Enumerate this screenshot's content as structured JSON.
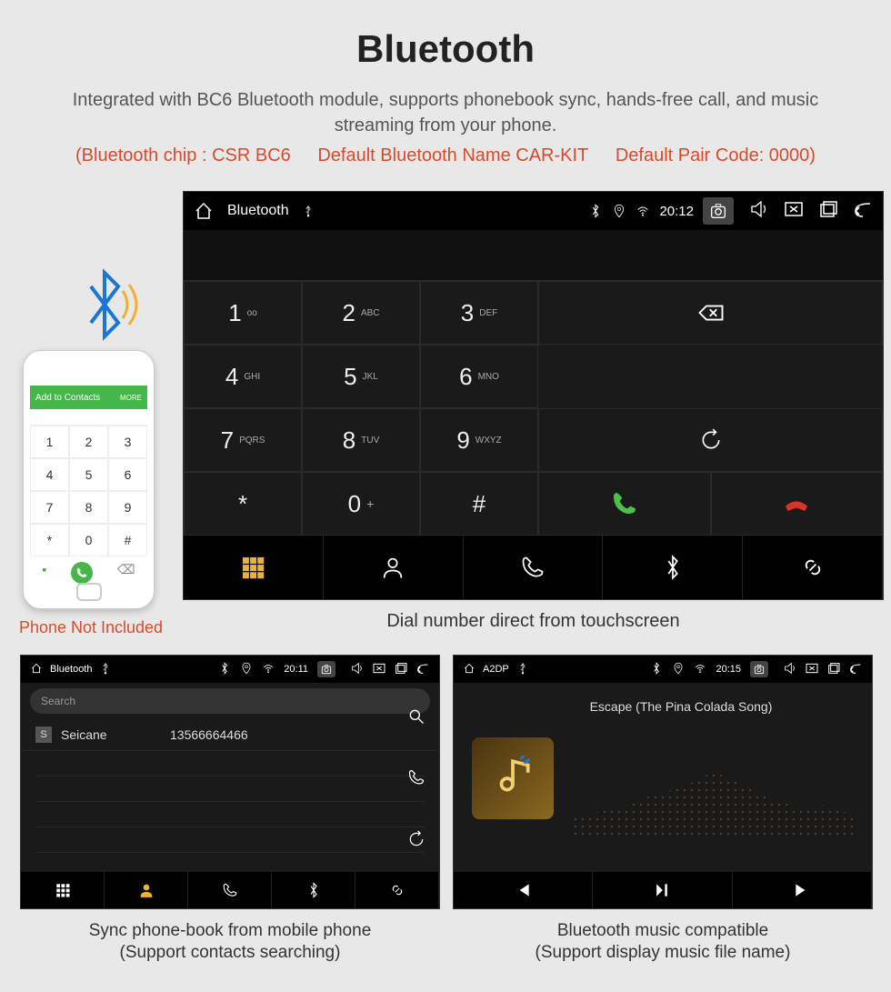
{
  "page": {
    "title": "Bluetooth",
    "subtitle": "Integrated with BC6 Bluetooth module, supports phonebook sync, hands-free call, and music streaming from your phone.",
    "spec_chip": "(Bluetooth chip : CSR BC6",
    "spec_name": "Default Bluetooth Name CAR-KIT",
    "spec_pair": "Default Pair Code: 0000)"
  },
  "dialer": {
    "statusbar_title": "Bluetooth",
    "time": "20:12",
    "keys": [
      {
        "num": "1",
        "sub": "oo"
      },
      {
        "num": "2",
        "sub": "ABC"
      },
      {
        "num": "3",
        "sub": "DEF"
      },
      {
        "num": "4",
        "sub": "GHI"
      },
      {
        "num": "5",
        "sub": "JKL"
      },
      {
        "num": "6",
        "sub": "MNO"
      },
      {
        "num": "7",
        "sub": "PQRS"
      },
      {
        "num": "8",
        "sub": "TUV"
      },
      {
        "num": "9",
        "sub": "WXYZ"
      },
      {
        "num": "*",
        "sub": ""
      },
      {
        "num": "0",
        "sub": "+"
      },
      {
        "num": "#",
        "sub": ""
      }
    ],
    "caption": "Dial number direct from touchscreen"
  },
  "phone": {
    "topbar_label": "Add to Contacts",
    "topbar_right": "MORE",
    "caption": "Phone Not Included"
  },
  "phonebook": {
    "statusbar_title": "Bluetooth",
    "time": "20:11",
    "search_placeholder": "Search",
    "contact": {
      "badge": "S",
      "name": "Seicane",
      "number": "13566664466"
    },
    "caption_line1": "Sync phone-book from mobile phone",
    "caption_line2": "(Support contacts searching)"
  },
  "music": {
    "statusbar_title": "A2DP",
    "time": "20:15",
    "song_title": "Escape (The Pina Colada Song)",
    "caption_line1": "Bluetooth music compatible",
    "caption_line2": "(Support display music file name)"
  }
}
